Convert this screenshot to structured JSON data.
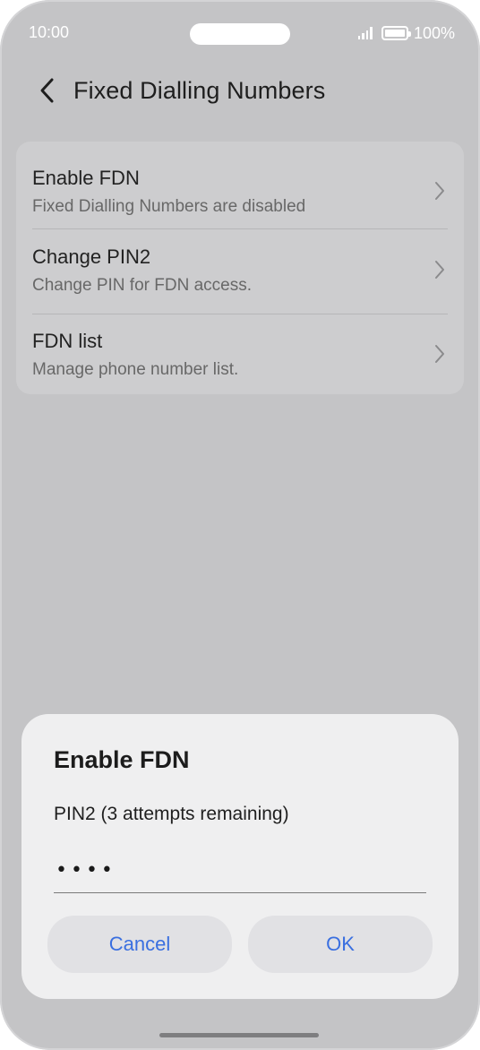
{
  "status_bar": {
    "time": "10:00",
    "battery": "100%"
  },
  "header": {
    "title": "Fixed Dialling Numbers",
    "back_icon": "chevron-left-icon"
  },
  "settings": {
    "items": [
      {
        "title": "Enable FDN",
        "subtitle": "Fixed Dialling Numbers are disabled"
      },
      {
        "title": "Change PIN2",
        "subtitle": "Change PIN for FDN access."
      },
      {
        "title": "FDN list",
        "subtitle": "Manage phone number list."
      }
    ]
  },
  "dialog": {
    "title": "Enable FDN",
    "label": "PIN2 (3 attempts remaining)",
    "pin_value": "••••",
    "cancel_label": "Cancel",
    "ok_label": "OK"
  },
  "colors": {
    "accent": "#3a6fe0",
    "background_dimmed": "#c4c4c6",
    "dialog_bg": "#efeff0"
  }
}
